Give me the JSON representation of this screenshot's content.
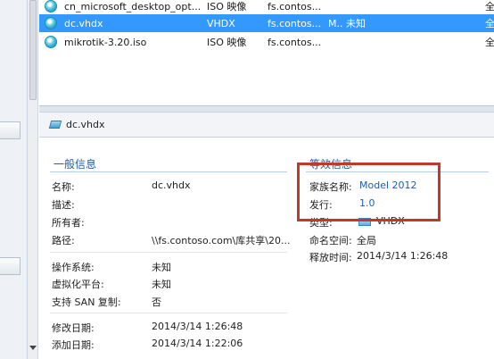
{
  "file_list": {
    "rows": [
      {
        "name": "cn_microsoft_desktop_opt...",
        "type": "ISO 映像",
        "location": "fs.contos...",
        "status": "",
        "all": "全",
        "selected": false
      },
      {
        "name": "dc.vhdx",
        "type": "VHDX",
        "location": "fs.contos...",
        "status": "M.. 未知",
        "all": "全",
        "selected": true
      },
      {
        "name": "mikrotik-3.20.iso",
        "type": "ISO 映像",
        "location": "fs.contos...",
        "status": "",
        "all": "全",
        "selected": false
      }
    ]
  },
  "details": {
    "title": "dc.vhdx",
    "general": {
      "heading": "一般信息",
      "name_label": "名称:",
      "name_value": "dc.vhdx",
      "desc_label": "描述:",
      "owner_label": "所有者:",
      "path_label": "路径:",
      "path_value": "\\\\fs.contoso.com\\库共享\\20...",
      "os_label": "操作系统:",
      "os_value": "未知",
      "virt_label": "虚拟化平台:",
      "virt_value": "未知",
      "san_label": "支持 SAN 复制:",
      "san_value": "否",
      "modified_label": "修改日期:",
      "modified_value": "2014/3/14 1:26:48",
      "added_label": "添加日期:",
      "added_value": "2014/3/14 1:22:06"
    },
    "equivalent": {
      "heading": "等效信息",
      "family_label": "家族名称:",
      "family_value": "Model 2012",
      "release_label": "发行:",
      "release_value": "1.0",
      "type_label": "类型:",
      "type_value": "VHDX",
      "namespace_label": "命名空间:",
      "namespace_value": "全局",
      "release_time_label": "释放时间:",
      "release_time_value": "2014/3/14 1:26:48"
    }
  },
  "colors": {
    "selection": "#3399ff",
    "highlight_box": "#c0392b",
    "link": "#1f5ea8"
  }
}
